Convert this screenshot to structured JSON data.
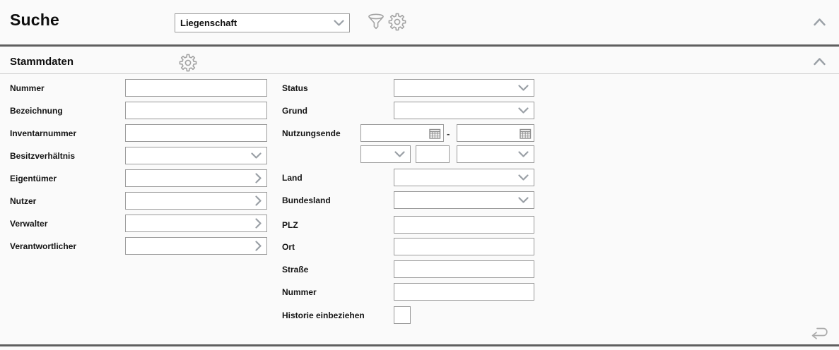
{
  "colors": {
    "page_background": "#fafafa",
    "input_background": "#ffffff",
    "input_border": "#9a9a9a",
    "divider_dark": "#5f5f5f",
    "divider_light": "#cfcfcf",
    "icon_gray": "#a3a3a3",
    "text": "#111111"
  },
  "header": {
    "title": "Suche",
    "search_type_select": {
      "value": "Liegenschaft"
    }
  },
  "stammdaten": {
    "title": "Stammdaten",
    "fields": {
      "nummer": {
        "label": "Nummer",
        "value": ""
      },
      "bezeichnung": {
        "label": "Bezeichnung",
        "value": ""
      },
      "inventarnummer": {
        "label": "Inventarnummer",
        "value": ""
      },
      "besitzverhaeltnis": {
        "label": "Besitzverhältnis",
        "value": ""
      },
      "eigentuemer": {
        "label": "Eigentümer",
        "value": ""
      },
      "nutzer": {
        "label": "Nutzer",
        "value": ""
      },
      "verwalter": {
        "label": "Verwalter",
        "value": ""
      },
      "verantwortlicher": {
        "label": "Verantwortlicher",
        "value": ""
      },
      "status": {
        "label": "Status",
        "value": ""
      },
      "grund": {
        "label": "Grund",
        "value": ""
      },
      "nutzungsende": {
        "label": "Nutzungsende",
        "date_from": "",
        "date_to": "",
        "separator": "-",
        "relative_unit": "",
        "relative_amount": "",
        "relative_period": ""
      },
      "land": {
        "label": "Land",
        "value": ""
      },
      "bundesland": {
        "label": "Bundesland",
        "value": ""
      },
      "plz": {
        "label": "PLZ",
        "value": ""
      },
      "ort": {
        "label": "Ort",
        "value": ""
      },
      "strasse": {
        "label": "Straße",
        "value": ""
      },
      "hausnummer": {
        "label": "Nummer",
        "value": ""
      },
      "historie_einbeziehen": {
        "label": "Historie einbeziehen",
        "checked": false
      }
    }
  }
}
